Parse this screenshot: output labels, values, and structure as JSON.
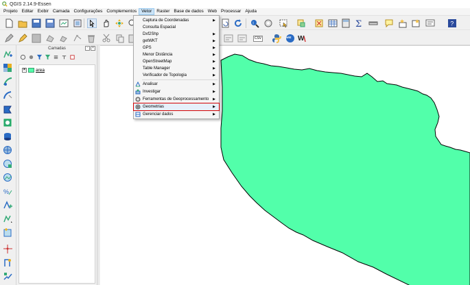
{
  "window": {
    "title": "QGIS 2.14.9-Essen"
  },
  "menubar": {
    "items": [
      "Projeto",
      "Editar",
      "Exibir",
      "Camada",
      "Configurações",
      "Complementos",
      "Vetor",
      "Raster",
      "Base de dados",
      "Web",
      "Processar",
      "Ajuda"
    ],
    "active": "Vetor"
  },
  "vector_menu": {
    "items": [
      {
        "label": "Captura de Coordenadas",
        "submenu": true,
        "icon": ""
      },
      {
        "label": "Consulta Espacial",
        "submenu": false,
        "icon": ""
      },
      {
        "label": "Dxf2Shp",
        "submenu": true,
        "icon": ""
      },
      {
        "label": "getWKT",
        "submenu": true,
        "icon": ""
      },
      {
        "label": "GPS",
        "submenu": true,
        "icon": ""
      },
      {
        "label": "Menor Distância",
        "submenu": true,
        "icon": ""
      },
      {
        "label": "OpenStreetMap",
        "submenu": true,
        "icon": ""
      },
      {
        "label": "Table Manager",
        "submenu": true,
        "icon": ""
      },
      {
        "label": "Verificador de Topologia",
        "submenu": true,
        "icon": ""
      },
      {
        "label": "Analisar",
        "submenu": true,
        "icon": "analysis-icon"
      },
      {
        "label": "Investigar",
        "submenu": true,
        "icon": "research-icon"
      },
      {
        "label": "Ferramentas de Geoprocessamento",
        "submenu": true,
        "icon": "geoprocessing-icon"
      },
      {
        "label": "Geometrias",
        "submenu": true,
        "icon": "geometry-icon",
        "highlighted": true
      },
      {
        "label": "Gerenciar dados",
        "submenu": true,
        "icon": "data-management-icon"
      }
    ]
  },
  "layers_panel": {
    "title": "Camadas",
    "layers": [
      {
        "name": "area",
        "checked": true,
        "color": "#52ffaa"
      }
    ]
  },
  "toolbar2": {
    "csv_label": "CSV",
    "wkt_label": "wkt"
  },
  "map": {
    "fill_color": "#52ffaa",
    "stroke_color": "#000000"
  }
}
